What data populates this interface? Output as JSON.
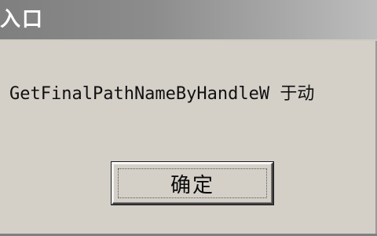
{
  "window": {
    "title": "入口"
  },
  "dialog": {
    "message": "GetFinalPathNameByHandleW 于动",
    "ok_label": "确定"
  },
  "colors": {
    "titlebar_start": "#7f7f7f",
    "titlebar_end": "#bdbdbd",
    "dialog_face": "#d4d0c8",
    "text": "#101010"
  }
}
